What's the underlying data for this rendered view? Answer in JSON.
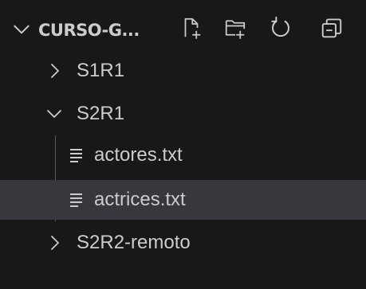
{
  "explorer": {
    "title": "CURSO-G...",
    "actions": {
      "new_file": "new-file-icon",
      "new_folder": "new-folder-icon",
      "refresh": "refresh-icon",
      "collapse_all": "collapse-all-icon"
    },
    "tree": [
      {
        "label": "S1R1",
        "type": "folder",
        "expanded": false
      },
      {
        "label": "S2R1",
        "type": "folder",
        "expanded": true
      },
      {
        "label": "actores.txt",
        "type": "file"
      },
      {
        "label": "actrices.txt",
        "type": "file",
        "selected": true
      },
      {
        "label": "S2R2-remoto",
        "type": "folder",
        "expanded": false
      }
    ],
    "colors": {
      "background": "#181818",
      "text": "#cccccc",
      "selection": "#37373d",
      "indent_guide": "#585858"
    }
  }
}
